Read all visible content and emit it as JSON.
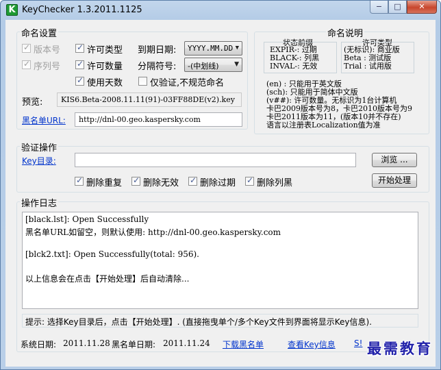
{
  "window": {
    "title": "KeyChecker 1.3.2011.1125",
    "icon": "K",
    "min_symbol": "−",
    "max_symbol": "□",
    "close_symbol": "✕"
  },
  "naming": {
    "group_title": "命名设置",
    "version_label": "版本号",
    "serial_label": "序列号",
    "license_type_label": "许可类型",
    "license_count_label": "许可数量",
    "use_days_label": "使用天数",
    "expiry_label": "到期日期:",
    "expiry_value": "YYYY.MM.DD",
    "separator_label": "分隔符号:",
    "separator_value": "-(中划线)",
    "verify_only_label": "仅验证,不规范命名",
    "preview_label": "预览:",
    "preview_value": "KIS6.Beta-2008.11.11(91)-03FF88DE(v2).key",
    "blacklist_url_label": "黑名单URL:",
    "blacklist_url_value": "http://dnl-00.geo.kaspersky.com"
  },
  "help": {
    "title": "命名说明",
    "prefix_header": "状态前缀",
    "prefix_lines": [
      "EXPIR-: 过期",
      "BLACK-: 列黑",
      "INVAL-: 无效"
    ],
    "type_header": "许可类型",
    "type_lines": [
      "(无标识): 商业版",
      "Beta  : 测试版",
      "Trial : 试用版"
    ],
    "notes": [
      "(en) : 只能用于英文版",
      "(sch): 只能用于简体中文版",
      "(v##): 许可数量。无标识为1台计算机",
      "卡巴2009版本号为8，卡巴2010版本号为9",
      "卡巴2011版本为11，(版本10并不存在)",
      "语言以注册表Localization值为准"
    ]
  },
  "verify": {
    "group_title": "验证操作",
    "key_dir_label": "Key目录:",
    "key_dir_value": "",
    "browse_button": "浏览 ...",
    "remove_dup_label": "删除重复",
    "remove_invalid_label": "删除无效",
    "remove_expired_label": "删除过期",
    "remove_black_label": "删除列黑",
    "start_button": "开始处理"
  },
  "log": {
    "group_title": "操作日志",
    "lines": [
      "[black.lst]: Open Successfully",
      "黑名单URL如留空，则默认使用: http://dnl-00.geo.kaspersky.com",
      "",
      "[blck2.txt]: Open Successfully(total: 956).",
      "",
      "以上信息会在点击【开始处理】后自动清除..."
    ]
  },
  "hint": "提示: 选择Key目录后，点击【开始处理】.  (直接拖曳单个/多个Key文件到界面将显示Key信息).",
  "footer": {
    "system_date_label": "系统日期:",
    "system_date_value": "2011.11.28",
    "blacklist_date_label": "黑名单日期:",
    "blacklist_date_value": "2011.11.24",
    "download_link": "下载黑名单",
    "view_key_link": "查看Key信息",
    "partial_link": "S!"
  },
  "watermark": "最需教育"
}
